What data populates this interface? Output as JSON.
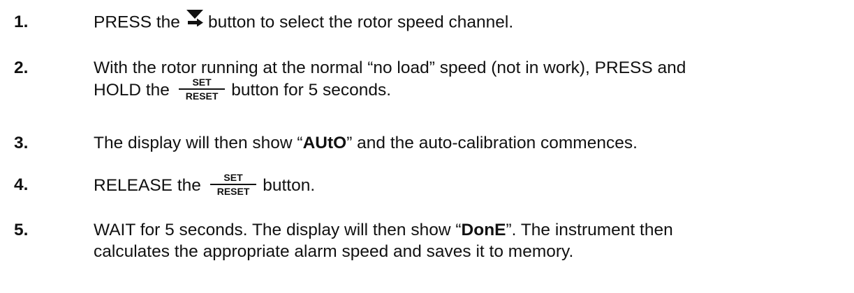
{
  "steps": [
    {
      "number": "1.",
      "before": "PRESS the",
      "icon": "down-arrow-button-icon",
      "after": "button to select the rotor speed channel."
    },
    {
      "number": "2.",
      "line1": "With the rotor running at the normal “no load” speed (not in work), PRESS and",
      "before": "HOLD the",
      "button_top": "SET",
      "button_bottom": "RESET",
      "after": "button for 5 seconds."
    },
    {
      "number": "3.",
      "before": "The display will then show “",
      "bold": "AUtO",
      "after": "” and the auto-calibration commences."
    },
    {
      "number": "4.",
      "before": "RELEASE the",
      "button_top": "SET",
      "button_bottom": "RESET",
      "after": "button."
    },
    {
      "number": "5.",
      "before": "WAIT for 5 seconds. The display will then show “",
      "bold": "DonE",
      "after": "”. The instrument then",
      "line2": "calculates the appropriate alarm speed and saves it to memory."
    }
  ]
}
